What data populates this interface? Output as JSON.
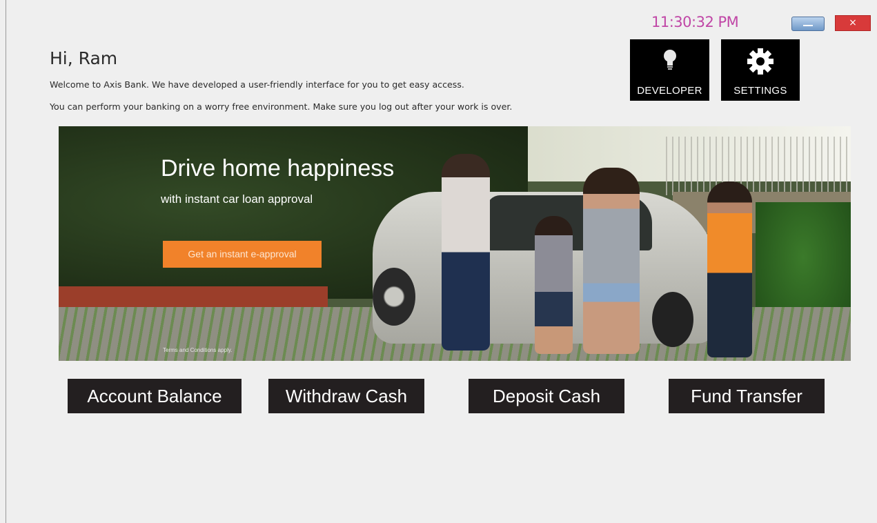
{
  "header": {
    "clock": "11:30:32 PM",
    "greeting": "Hi, Ram",
    "welcome_line1": "Welcome to Axis Bank. We have developed a user-friendly interface for you to get easy access.",
    "welcome_line2": "You can perform your banking on a worry free environment. Make sure you log out after your work is over."
  },
  "window_controls": {
    "close_label": "×",
    "minimize_icon": "minimize-icon",
    "close_icon": "close-icon"
  },
  "tiles": {
    "developer": {
      "label": "DEVELOPER",
      "icon": "lightbulb-icon"
    },
    "settings": {
      "label": "SETTINGS",
      "icon": "gear-icon"
    }
  },
  "banner": {
    "title": "Drive home happiness",
    "subtitle": "with instant car loan approval",
    "cta": "Get an instant e-approval",
    "terms": "Terms and Conditions apply."
  },
  "actions": [
    {
      "label": "Account Balance"
    },
    {
      "label": "Withdraw Cash"
    },
    {
      "label": "Deposit Cash"
    },
    {
      "label": "Fund Transfer"
    }
  ],
  "colors": {
    "background": "#efefef",
    "clock": "#c046a6",
    "tile": "#000000",
    "action_button": "#231f20",
    "cta": "#f1822a",
    "close": "#d83a3a"
  }
}
